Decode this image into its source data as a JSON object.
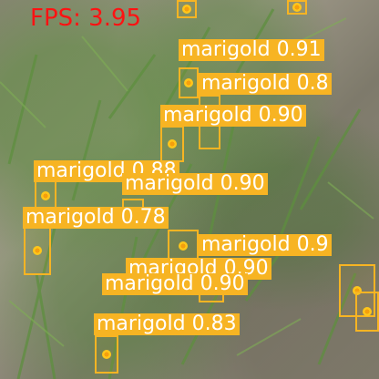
{
  "fps_text": "FPS: 3.95",
  "colors": {
    "box": "#f7b423",
    "label_text": "#ffffff",
    "fps": "#ff1212"
  },
  "detections": [
    {
      "label": "marigold",
      "score": "0.91"
    },
    {
      "label": "marigold",
      "score": "0.8"
    },
    {
      "label": "marigold",
      "score": "0.90"
    },
    {
      "label": "marigold",
      "score": "0.88"
    },
    {
      "label": "marigold",
      "score": "0.90"
    },
    {
      "label": "marigold",
      "score": "0.78"
    },
    {
      "label": "marigold",
      "score": "0.9"
    },
    {
      "label": "marigold",
      "score": "0.90"
    },
    {
      "label": "marigold",
      "score": "0.90"
    },
    {
      "label": "marigold",
      "score": "0.83"
    }
  ]
}
